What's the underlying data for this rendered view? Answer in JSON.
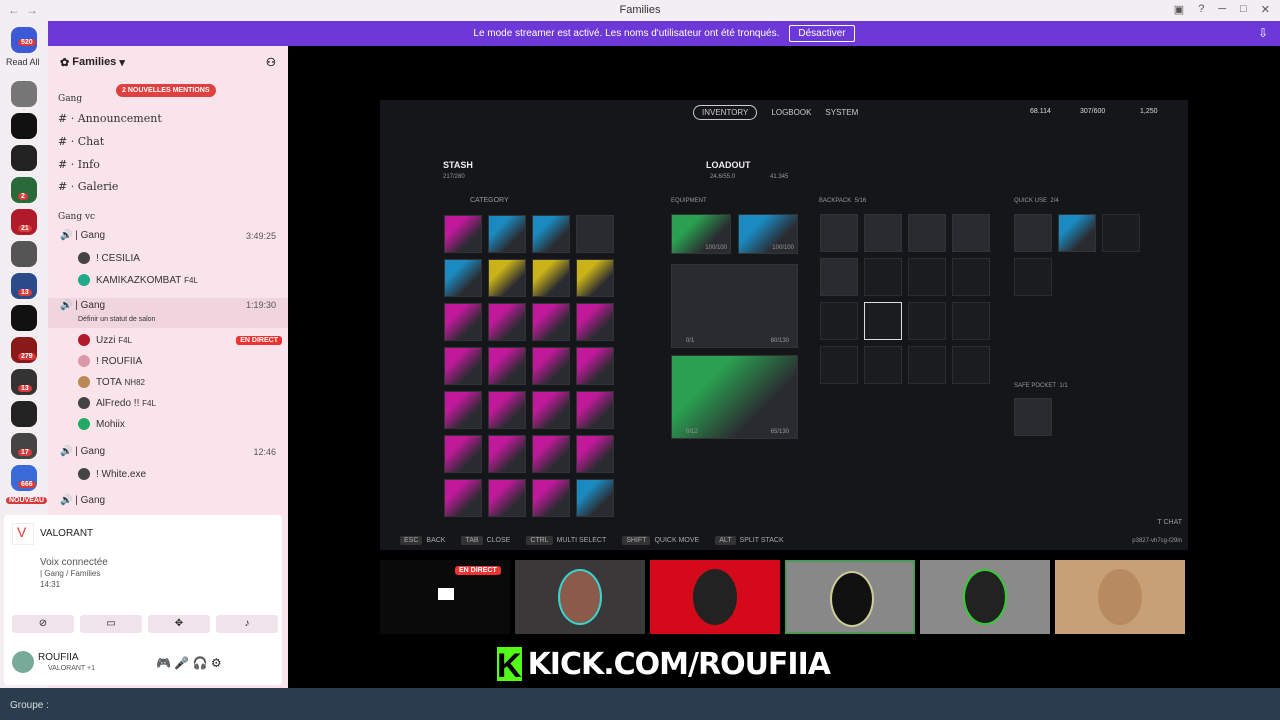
{
  "window": {
    "title": "Families"
  },
  "banner": {
    "text": "Le mode streamer est activé. Les noms d'utilisateur ont été tronqués.",
    "button": "Désactiver"
  },
  "rail": {
    "read_all": "Read All",
    "badges": [
      "520",
      "2",
      "21",
      "13",
      "279",
      "13",
      "17",
      "666",
      "NOUVEAU"
    ]
  },
  "server": {
    "name": "Families"
  },
  "mention_badge": "2 NOUVELLES MENTIONS",
  "categories": [
    {
      "name": "Gang",
      "channels": [
        "Announcement",
        "Chat",
        "Info",
        "Galerie"
      ]
    },
    {
      "name": "Gang vc"
    }
  ],
  "voice": [
    {
      "name": "| Gang",
      "time": "3:49:25",
      "users": [
        {
          "name": "! CESILIA"
        },
        {
          "name": "KAMIKAZKOMBAT",
          "tag": "F4L"
        }
      ]
    },
    {
      "name": "| Gang",
      "time": "1:19:30",
      "status": "Définir un statut de salon",
      "users": [
        {
          "name": "Uzzi",
          "tag": "F4L",
          "live": "EN DIRECT"
        },
        {
          "name": "! ROUFIIA"
        },
        {
          "name": "TOTA",
          "tag": "NH82"
        },
        {
          "name": "AlFredo !!",
          "tag": "F4L"
        },
        {
          "name": "Mohiix"
        }
      ]
    },
    {
      "name": "| Gang",
      "time": "12:46",
      "users": [
        {
          "name": "! White.exe"
        }
      ]
    },
    {
      "name": "| Gang"
    }
  ],
  "activity": {
    "game": "VALORANT",
    "connected": "Voix connectée",
    "path": "| Gang / Families",
    "duration": "14:31"
  },
  "user": {
    "name": "ROUFIIA",
    "status": "VALORANT +1"
  },
  "bottombar": {
    "label": "Groupe :"
  },
  "game": {
    "tabs": [
      "INVENTORY",
      "LOGBOOK",
      "SYSTEM"
    ],
    "currency": [
      "68.114",
      "307/600",
      "1,250"
    ],
    "stash": {
      "title": "STASH",
      "count": "217/280",
      "filter": "CATEGORY"
    },
    "loadout": {
      "title": "LOADOUT",
      "weight": "24.6/55.0",
      "value": "41.345"
    },
    "equipment": "EQUIPMENT",
    "equip_vals": [
      "100/100",
      "100/100",
      "0/1",
      "80/130",
      "0/12",
      "65/130"
    ],
    "backpack": {
      "label": "BACKPACK",
      "count": "5/16"
    },
    "quickuse": {
      "label": "QUICK USE",
      "count": "2/4"
    },
    "safepocket": {
      "label": "SAFE POCKET",
      "count": "1/1"
    },
    "footer": [
      {
        "key": "ESC",
        "label": "BACK"
      },
      {
        "key": "TAB",
        "label": "CLOSE"
      },
      {
        "key": "CTRL",
        "label": "MULTI SELECT"
      },
      {
        "key": "SHIFT",
        "label": "QUICK MOVE"
      },
      {
        "key": "ALT",
        "label": "SPLIT STACK"
      },
      {
        "key": "T",
        "label": "CHAT"
      }
    ],
    "session": "p3827-vh7cg-f29ln"
  },
  "tiles": {
    "live": "EN DIRECT"
  },
  "kick": {
    "letter": "K",
    "text": "KICK.COM/ROUFIIA"
  }
}
